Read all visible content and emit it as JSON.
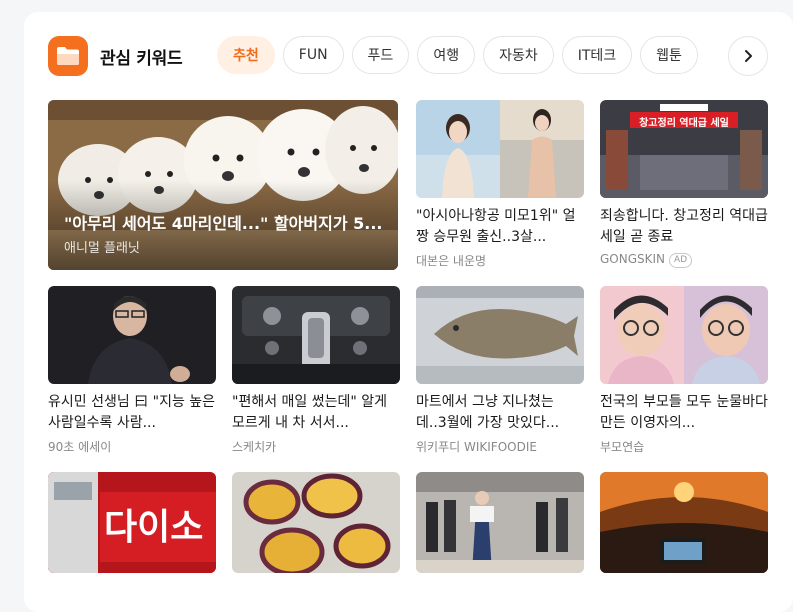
{
  "header": {
    "title": "관심 키워드",
    "icon": "folder-icon",
    "accent": "#f4701f"
  },
  "chips": [
    {
      "label": "추천",
      "active": true
    },
    {
      "label": "FUN"
    },
    {
      "label": "푸드"
    },
    {
      "label": "여행"
    },
    {
      "label": "자동차"
    },
    {
      "label": "IT테크"
    },
    {
      "label": "웹툰"
    }
  ],
  "hero": {
    "title": "\"아무리 세어도 4마리인데...\" 할아버지가 5...",
    "source": "애니멀 플래닛",
    "image": "puppies-in-box"
  },
  "row1": [
    {
      "title": "\"아시아나항공 미모1위\" 얼짱 승무원 출신..3살...",
      "source": "대본은 내운명",
      "image": "woman-by-sea"
    },
    {
      "title": "죄송합니다. 창고정리 역대급 세일 곧 종료",
      "source": "GONGSKIN",
      "ad": "AD",
      "image": "warehouse-sale",
      "banner": "창고정리 역대급 세일"
    }
  ],
  "row2": [
    {
      "title": "유시민 선생님 曰 \"지능 높은 사람일수록 사람...",
      "source": "90초 에세이",
      "image": "man-speaking"
    },
    {
      "title": "\"편해서 매일 썼는데\" 알게 모르게 내 차 서서...",
      "source": "스케치카",
      "image": "car-gear-shift"
    },
    {
      "title": "마트에서 그냥 지나쳤는데..3월에 가장 맛있다...",
      "source": "위키푸디 WIKIFOODIE",
      "image": "flatfish"
    },
    {
      "title": "전국의 부모들 모두 눈물바다 만든 이영자의...",
      "source": "부모연습",
      "image": "woman-crying"
    }
  ],
  "row3": [
    {
      "image": "daiso-storefront",
      "sign": "다이소"
    },
    {
      "image": "sweet-potatoes"
    },
    {
      "image": "hanbok-event"
    },
    {
      "image": "car-tunnel"
    }
  ]
}
